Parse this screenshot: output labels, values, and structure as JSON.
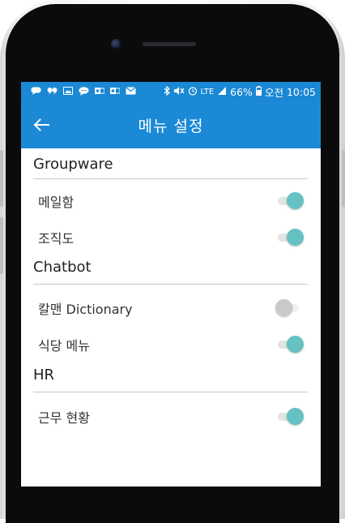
{
  "status_bar": {
    "battery": "66%",
    "ampm": "오전",
    "time": "10:05",
    "network": "LTE",
    "notification_icons": [
      "chat-icon",
      "quote-icon",
      "image-icon",
      "message-icon",
      "outlook-icon",
      "outlook-icon",
      "mail-icon"
    ],
    "bar_color": "#1a88d4"
  },
  "app_bar": {
    "title": "메뉴 설정",
    "color": "#1b89d6"
  },
  "sections": [
    {
      "title": "Groupware",
      "items": [
        {
          "label": "메일함",
          "enabled": true
        },
        {
          "label": "조직도",
          "enabled": true
        }
      ]
    },
    {
      "title": "Chatbot",
      "items": [
        {
          "label": "칼맨 Dictionary",
          "enabled": false
        },
        {
          "label": "식당 메뉴",
          "enabled": true
        }
      ]
    },
    {
      "title": "HR",
      "items": [
        {
          "label": "근무 현황",
          "enabled": true
        }
      ]
    }
  ],
  "colors": {
    "toggle_on": "#66c1c3",
    "toggle_off": "#c9c9c9"
  }
}
